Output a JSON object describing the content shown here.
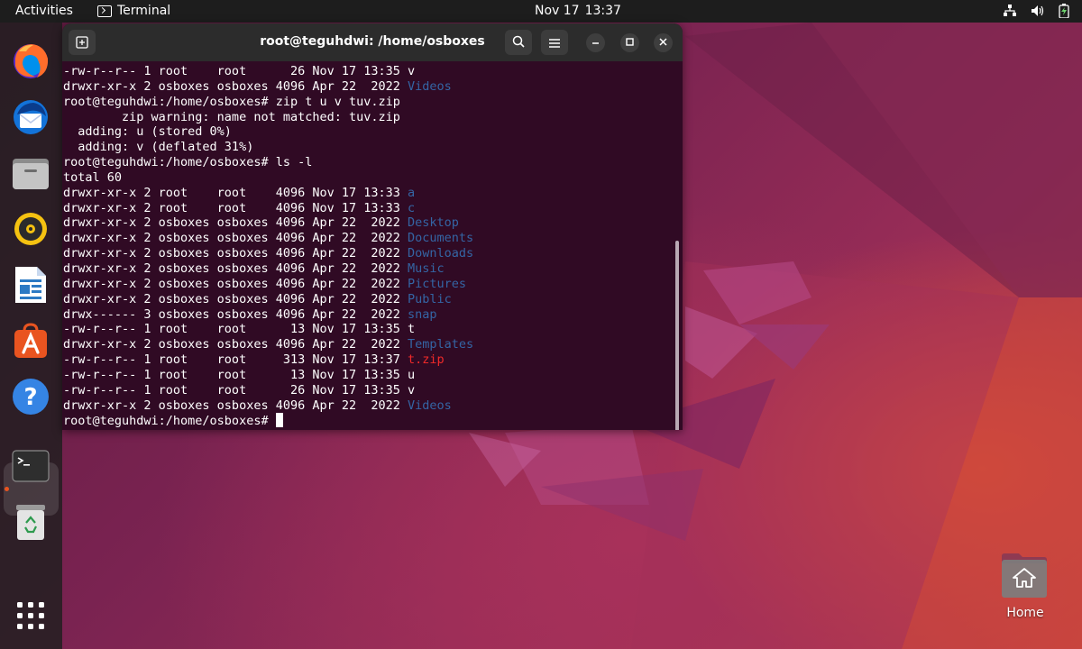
{
  "topbar": {
    "activities": "Activities",
    "app_name": "Terminal",
    "date": "Nov 17",
    "time": "13:37",
    "tray_icons": [
      "network-icon",
      "volume-icon",
      "battery-icon"
    ]
  },
  "dock": {
    "items": [
      {
        "name": "firefox",
        "icon": "firefox-icon"
      },
      {
        "name": "thunderbird",
        "icon": "thunderbird-icon"
      },
      {
        "name": "files",
        "icon": "files-icon"
      },
      {
        "name": "rhythmbox",
        "icon": "rhythmbox-icon"
      },
      {
        "name": "libreoffice-writer",
        "icon": "writer-icon"
      },
      {
        "name": "ubuntu-software",
        "icon": "software-icon"
      },
      {
        "name": "help",
        "icon": "help-icon"
      },
      {
        "name": "terminal",
        "icon": "terminal-icon"
      },
      {
        "name": "trash",
        "icon": "trash-icon"
      },
      {
        "name": "show-apps",
        "icon": "grid-icon"
      }
    ],
    "accent": "#e95420"
  },
  "terminal": {
    "title": "root@teguhdwi: /home/osboxes",
    "lines": [
      [
        {
          "t": "-rw-r--r-- 1 root    root      26 Nov 17 13:35 v"
        }
      ],
      [
        {
          "t": "drwxr-xr-x 2 osboxes osboxes 4096 Apr 22  2022 "
        },
        {
          "t": "Videos",
          "c": "dir"
        }
      ],
      [
        {
          "t": "root@teguhdwi:/home/osboxes# zip t u v tuv.zip"
        }
      ],
      [
        {
          "t": "        zip warning: name not matched: tuv.zip"
        }
      ],
      [
        {
          "t": "  adding: u (stored 0%)"
        }
      ],
      [
        {
          "t": "  adding: v (deflated 31%)"
        }
      ],
      [
        {
          "t": "root@teguhdwi:/home/osboxes# ls -l"
        }
      ],
      [
        {
          "t": "total 60"
        }
      ],
      [
        {
          "t": "drwxr-xr-x 2 root    root    4096 Nov 17 13:33 "
        },
        {
          "t": "a",
          "c": "dir"
        }
      ],
      [
        {
          "t": "drwxr-xr-x 2 root    root    4096 Nov 17 13:33 "
        },
        {
          "t": "c",
          "c": "dir"
        }
      ],
      [
        {
          "t": "drwxr-xr-x 2 osboxes osboxes 4096 Apr 22  2022 "
        },
        {
          "t": "Desktop",
          "c": "dir"
        }
      ],
      [
        {
          "t": "drwxr-xr-x 2 osboxes osboxes 4096 Apr 22  2022 "
        },
        {
          "t": "Documents",
          "c": "dir"
        }
      ],
      [
        {
          "t": "drwxr-xr-x 2 osboxes osboxes 4096 Apr 22  2022 "
        },
        {
          "t": "Downloads",
          "c": "dir"
        }
      ],
      [
        {
          "t": "drwxr-xr-x 2 osboxes osboxes 4096 Apr 22  2022 "
        },
        {
          "t": "Music",
          "c": "dir"
        }
      ],
      [
        {
          "t": "drwxr-xr-x 2 osboxes osboxes 4096 Apr 22  2022 "
        },
        {
          "t": "Pictures",
          "c": "dir"
        }
      ],
      [
        {
          "t": "drwxr-xr-x 2 osboxes osboxes 4096 Apr 22  2022 "
        },
        {
          "t": "Public",
          "c": "dir"
        }
      ],
      [
        {
          "t": "drwx------ 3 osboxes osboxes 4096 Apr 22  2022 "
        },
        {
          "t": "snap",
          "c": "dir"
        }
      ],
      [
        {
          "t": "-rw-r--r-- 1 root    root      13 Nov 17 13:35 t"
        }
      ],
      [
        {
          "t": "drwxr-xr-x 2 osboxes osboxes 4096 Apr 22  2022 "
        },
        {
          "t": "Templates",
          "c": "dir"
        }
      ],
      [
        {
          "t": "-rw-r--r-- 1 root    root     313 Nov 17 13:37 "
        },
        {
          "t": "t.zip",
          "c": "red"
        }
      ],
      [
        {
          "t": "-rw-r--r-- 1 root    root      13 Nov 17 13:35 u"
        }
      ],
      [
        {
          "t": "-rw-r--r-- 1 root    root      26 Nov 17 13:35 v"
        }
      ],
      [
        {
          "t": "drwxr-xr-x 2 osboxes osboxes 4096 Apr 22  2022 "
        },
        {
          "t": "Videos",
          "c": "dir"
        }
      ],
      [
        {
          "t": "root@teguhdwi:/home/osboxes# "
        },
        {
          "t": "",
          "c": "cursor"
        }
      ]
    ],
    "colors": {
      "background": "#300a24",
      "directory": "#3465a4",
      "archive": "#ef2929"
    },
    "scroll_fraction": 0.57
  },
  "desktop": {
    "home_label": "Home"
  }
}
